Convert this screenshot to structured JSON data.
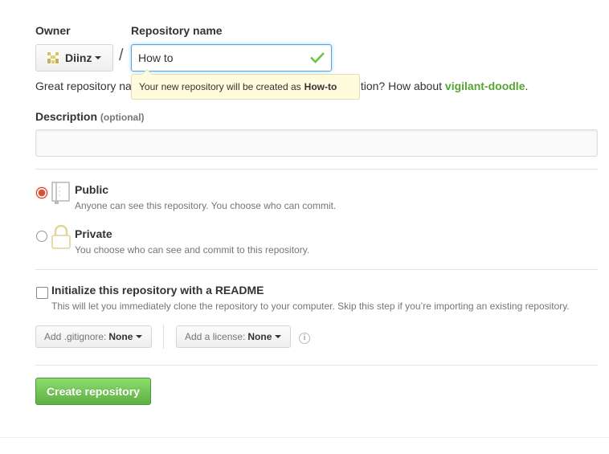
{
  "owner": {
    "label": "Owner",
    "name": "Diinz"
  },
  "repo": {
    "label": "Repository name",
    "value": "How to",
    "slash": "/"
  },
  "hint": {
    "prefix": "Great repository na",
    "suffix": "tion? How about ",
    "suggestion": "vigilant-doodle",
    "end": "."
  },
  "tooltip": {
    "text": "Your new repository will be created as",
    "name": "How-to"
  },
  "description": {
    "label": "Description",
    "optional": "(optional)",
    "placeholder": ""
  },
  "visibility": {
    "public": {
      "title": "Public",
      "note": "Anyone can see this repository. You choose who can commit."
    },
    "private": {
      "title": "Private",
      "note": "You choose who can see and commit to this repository."
    }
  },
  "readme": {
    "title": "Initialize this repository with a README",
    "note": "This will let you immediately clone the repository to your computer. Skip this step if you’re importing an existing repository."
  },
  "gitignore": {
    "label": "Add .gitignore:",
    "value": "None"
  },
  "license": {
    "label": "Add a license:",
    "value": "None"
  },
  "info_glyph": "i",
  "create_label": "Create repository",
  "colors": {
    "accent_blue": "#51a7e8",
    "success_green": "#6cc644",
    "create_green": "#60b044",
    "radio_red": "#d9502c"
  }
}
